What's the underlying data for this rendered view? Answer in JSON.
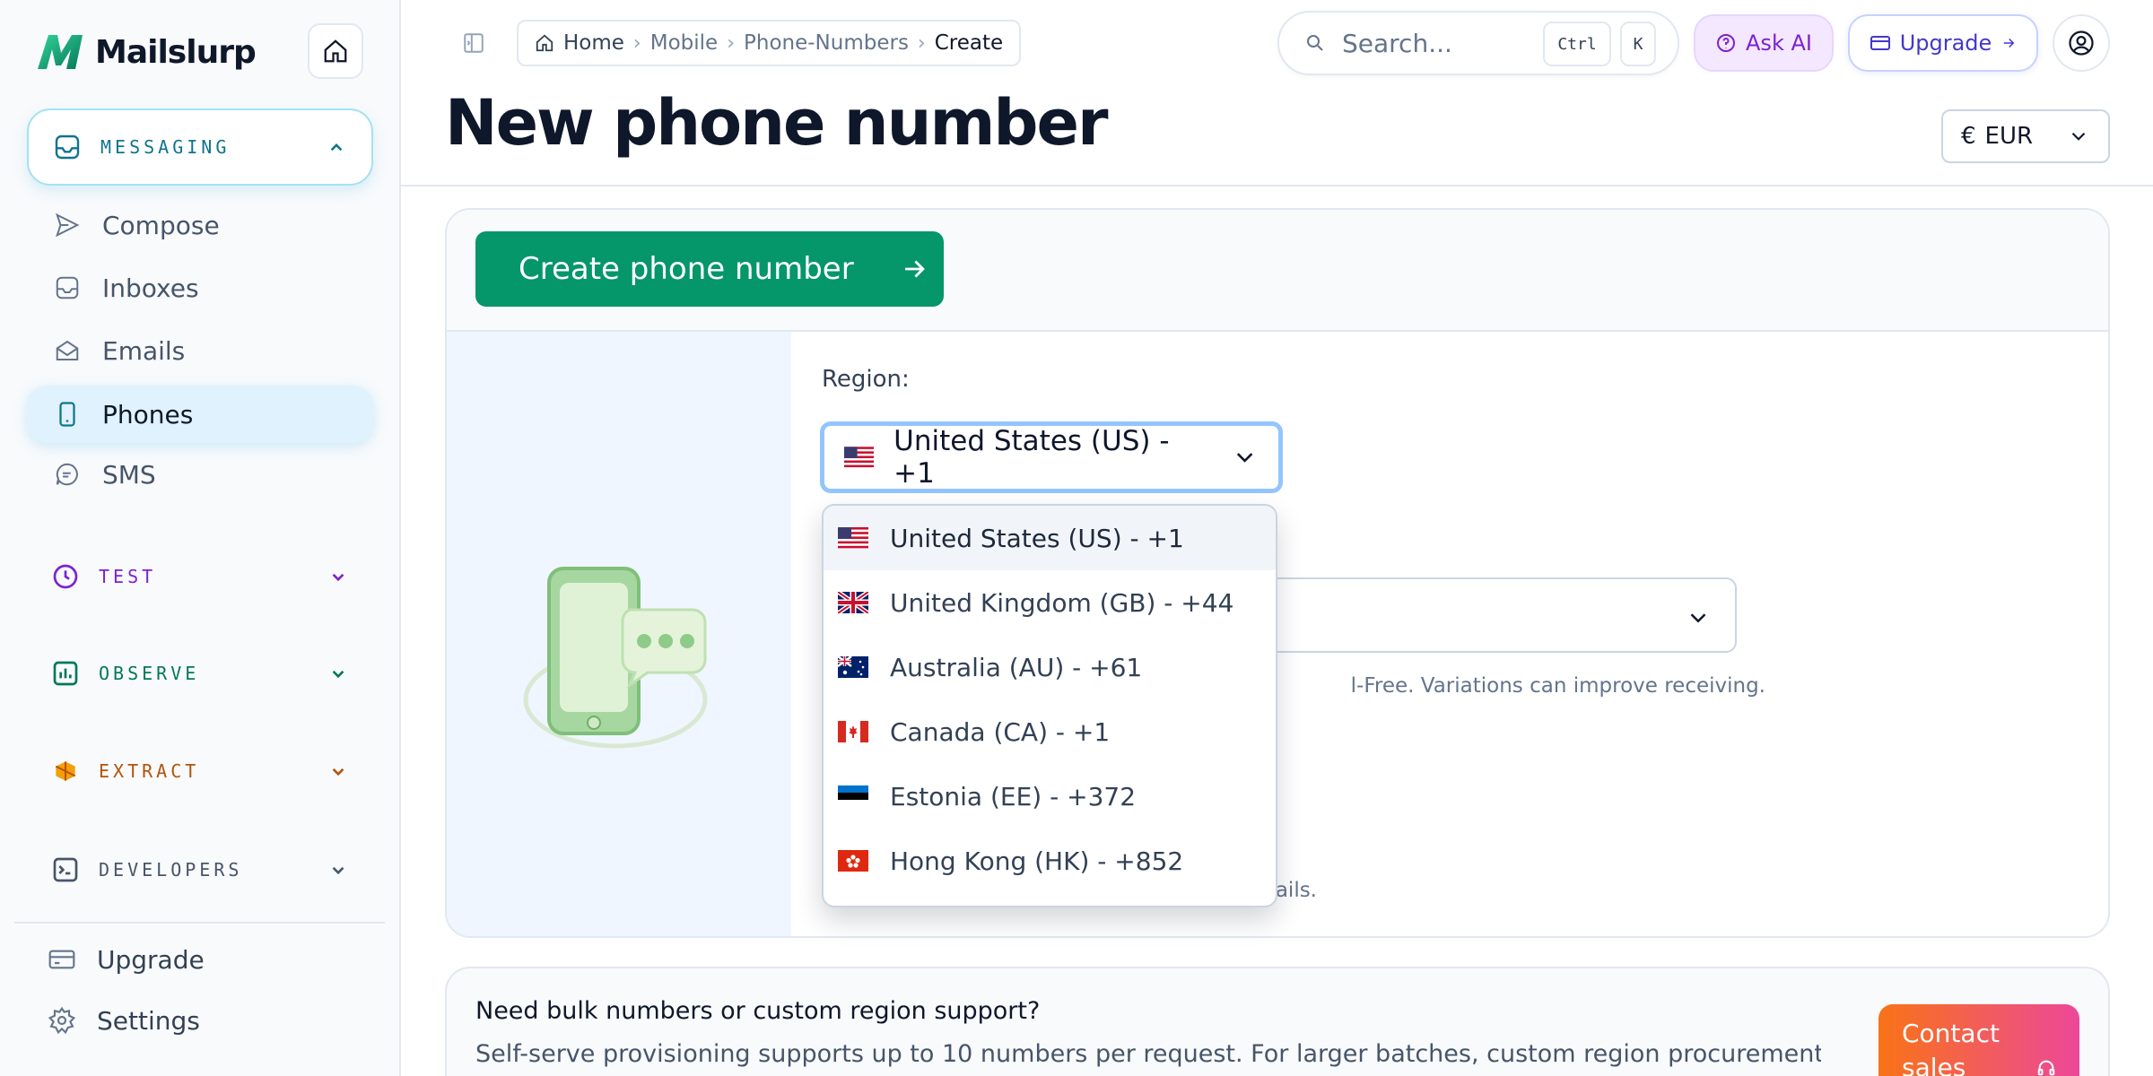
{
  "brand": {
    "name": "Mailslurp",
    "accent": "#059669"
  },
  "sidebar": {
    "groups": [
      {
        "label": "MESSAGING",
        "color": "#0e7490",
        "expanded": true
      },
      {
        "label": "TEST",
        "color": "#7e22ce"
      },
      {
        "label": "OBSERVE",
        "color": "#047857"
      },
      {
        "label": "EXTRACT",
        "color": "#b45309"
      },
      {
        "label": "DEVELOPERS",
        "color": "#475569"
      }
    ],
    "items": [
      {
        "label": "Compose",
        "icon": "send-icon"
      },
      {
        "label": "Inboxes",
        "icon": "inbox-icon"
      },
      {
        "label": "Emails",
        "icon": "envelope-open-icon"
      },
      {
        "label": "Phones",
        "icon": "phone-icon",
        "active": true
      },
      {
        "label": "SMS",
        "icon": "chat-icon"
      }
    ],
    "bottom": [
      {
        "label": "Upgrade",
        "icon": "credit-card-icon"
      },
      {
        "label": "Settings",
        "icon": "gear-icon"
      }
    ]
  },
  "breadcrumb": [
    "Home",
    "Mobile",
    "Phone-Numbers",
    "Create"
  ],
  "search": {
    "placeholder": "Search...",
    "kbd1": "Ctrl",
    "kbd2": "K"
  },
  "topbar": {
    "ask_ai": "Ask AI",
    "upgrade": "Upgrade"
  },
  "page": {
    "title": "New phone number"
  },
  "currency": {
    "symbol": "€",
    "value": "EUR"
  },
  "form": {
    "create_button": "Create phone number",
    "region_label": "Region:",
    "region_value": "United States (US) - +1",
    "type_hint_visible": "l-Free. Variations can improve receiving.",
    "quantity_hint_visible": "ails."
  },
  "dropdown": {
    "options": [
      {
        "label": "United States (US) - +1",
        "flag": "us-flag-icon",
        "selected": true
      },
      {
        "label": "United Kingdom (GB) - +44",
        "flag": "gb-flag-icon"
      },
      {
        "label": "Australia (AU) - +61",
        "flag": "au-flag-icon"
      },
      {
        "label": "Canada (CA) - +1",
        "flag": "ca-flag-icon"
      },
      {
        "label": "Estonia (EE) - +372",
        "flag": "ee-flag-icon"
      },
      {
        "label": "Hong Kong (HK) - +852",
        "flag": "hk-flag-icon"
      }
    ]
  },
  "bulk": {
    "title": "Need bulk numbers or custom region support?",
    "text": "Self-serve provisioning supports up to 10 numbers per request. For larger batches, custom region procurement, or managed",
    "contact_line1": "Contact",
    "contact_line2": "sales"
  }
}
